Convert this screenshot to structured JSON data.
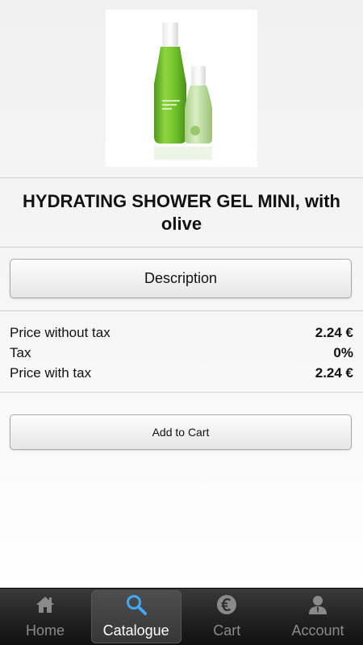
{
  "product": {
    "title": "HYDRATING SHOWER GEL MINI, with olive",
    "image_alt": "hydrating-shower-gel-bottles"
  },
  "actions": {
    "description_label": "Description",
    "add_to_cart_label": "Add to Cart"
  },
  "prices": [
    {
      "label": "Price without tax",
      "value": "2.24 €"
    },
    {
      "label": "Tax",
      "value": "0%"
    },
    {
      "label": "Price with tax",
      "value": "2.24 €"
    }
  ],
  "nav": {
    "active_tab": "catalogue",
    "tabs": [
      {
        "id": "home",
        "label": "Home",
        "icon": "home-icon"
      },
      {
        "id": "catalogue",
        "label": "Catalogue",
        "icon": "search-icon"
      },
      {
        "id": "cart",
        "label": "Cart",
        "icon": "euro-icon"
      },
      {
        "id": "account",
        "label": "Account",
        "icon": "user-icon"
      }
    ]
  },
  "colors": {
    "bottle_green": "#6fbe2a",
    "active_icon": "#3fa9f5",
    "nav_text": "#8a8a8a",
    "nav_active_text": "#ffffff"
  }
}
